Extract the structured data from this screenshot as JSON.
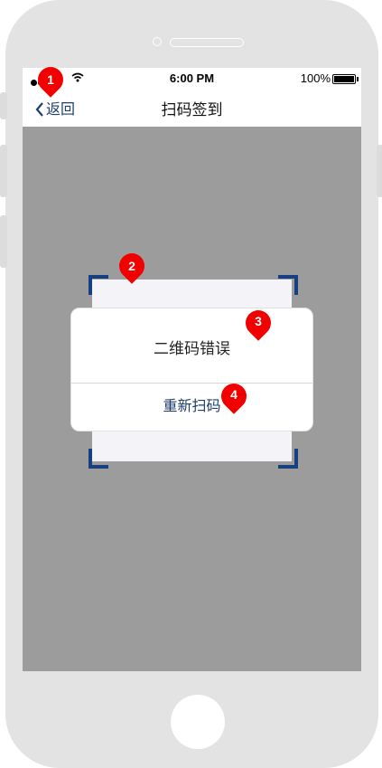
{
  "status_bar": {
    "time": "6:00 PM",
    "battery": "100%"
  },
  "nav": {
    "back_label": "返回",
    "title": "扫码签到"
  },
  "dialog": {
    "message": "二维码错误",
    "action": "重新扫码"
  },
  "markers": [
    "1",
    "2",
    "3",
    "4"
  ],
  "colors": {
    "accent": "#1d3f6e",
    "frame": "#183f7f",
    "marker": "#f20000",
    "overlay": "#9c9c9c"
  }
}
